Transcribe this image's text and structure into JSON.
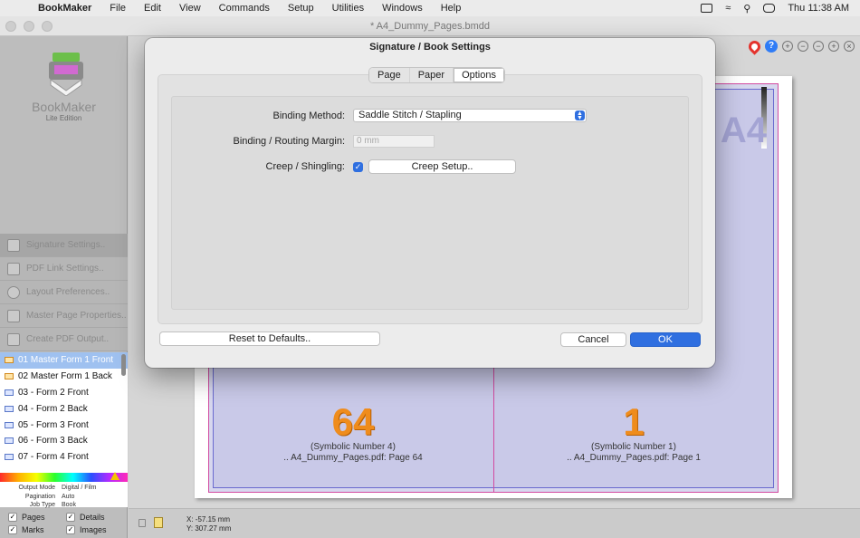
{
  "menubar": {
    "app_name": "BookMaker",
    "items": [
      "File",
      "Edit",
      "View",
      "Commands",
      "Setup",
      "Utilities",
      "Windows",
      "Help"
    ],
    "clock": "Thu 11:38 AM"
  },
  "window": {
    "title": "* A4_Dummy_Pages.bmdd"
  },
  "sidebar": {
    "logo_name": "BookMaker",
    "logo_edition": "Lite Edition",
    "tools": [
      {
        "label": "Signature Settings..",
        "icon": "signature-icon"
      },
      {
        "label": "PDF Link Settings..",
        "icon": "pdf-icon"
      },
      {
        "label": "Layout Preferences..",
        "icon": "gear-icon"
      },
      {
        "label": "Master Page Properties..",
        "icon": "page-icon"
      },
      {
        "label": "Create PDF Output..",
        "icon": "printer-icon"
      }
    ],
    "forms": [
      "01 Master Form 1 Front",
      "02 Master Form 1 Back",
      "03 - Form 2 Front",
      "04 - Form 2 Back",
      "05 - Form 3 Front",
      "06 - Form 3 Back",
      "07 - Form 4 Front"
    ],
    "info": [
      {
        "key": "Output Mode",
        "value": "Digital / Film"
      },
      {
        "key": "Pagination",
        "value": "Auto"
      },
      {
        "key": "Job Type",
        "value": "Book"
      }
    ],
    "checkboxes": [
      {
        "label": "Pages",
        "checked": true
      },
      {
        "label": "Details",
        "checked": true
      },
      {
        "label": "Marks",
        "checked": true
      },
      {
        "label": "Images",
        "checked": true
      }
    ]
  },
  "status": {
    "x": "X: -57.15 mm",
    "y": "Y: 307.27 mm"
  },
  "sheet": {
    "a4_mark": "A4",
    "left_page": {
      "number": "64",
      "symbolic": "(Symbolic Number 4)",
      "source": ".. A4_Dummy_Pages.pdf: Page 64"
    },
    "right_page": {
      "number": "1",
      "symbolic": "(Symbolic Number 1)",
      "source": ".. A4_Dummy_Pages.pdf: Page 1"
    }
  },
  "dialog": {
    "title": "Signature / Book Settings",
    "tabs": [
      "Page",
      "Paper",
      "Options"
    ],
    "active_tab": "Options",
    "binding_method_label": "Binding Method:",
    "binding_method_value": "Saddle Stitch / Stapling",
    "margin_label": "Binding / Routing Margin:",
    "margin_placeholder": "0 mm",
    "creep_label": "Creep / Shingling:",
    "creep_checked": true,
    "creep_button": "Creep Setup..",
    "reset_button": "Reset to Defaults..",
    "cancel_button": "Cancel",
    "ok_button": "OK"
  },
  "colors": {
    "accent": "#2f6fe0",
    "page_number": "#ef8c1c",
    "selection": "#9fc1f0"
  }
}
